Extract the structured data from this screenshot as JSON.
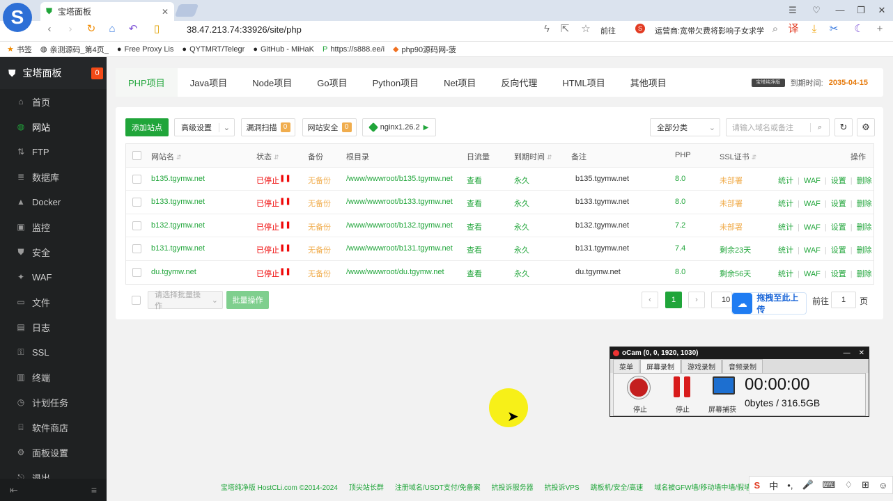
{
  "browser": {
    "tab_title": "宝塔面板",
    "url": "38.47.213.74:33926/site/php",
    "forward_label": "前往",
    "news_text": "运营商:宽带欠费将影响子女求学",
    "bookmarks": [
      {
        "icon": "star-icon",
        "label": "书签"
      },
      {
        "icon": "globe-icon",
        "label": "亲测源码_第4页_"
      },
      {
        "icon": "github-icon",
        "label": "Free Proxy Lis"
      },
      {
        "icon": "github-icon",
        "label": "QYTMRT/Telegr"
      },
      {
        "icon": "github-icon",
        "label": "GitHub - MiHaK"
      },
      {
        "icon": "tp-icon",
        "label": "https://s888.ee/i"
      },
      {
        "icon": "php-icon",
        "label": "php90源码网-菠"
      }
    ]
  },
  "sidebar": {
    "title": "宝塔面板",
    "badge": "0",
    "items": [
      {
        "label": "首页",
        "icon": "home-icon"
      },
      {
        "label": "网站",
        "icon": "globe-icon"
      },
      {
        "label": "FTP",
        "icon": "ftp-icon"
      },
      {
        "label": "数据库",
        "icon": "database-icon"
      },
      {
        "label": "Docker",
        "icon": "docker-icon"
      },
      {
        "label": "监控",
        "icon": "monitor-icon"
      },
      {
        "label": "安全",
        "icon": "shield-icon"
      },
      {
        "label": "WAF",
        "icon": "waf-icon"
      },
      {
        "label": "文件",
        "icon": "folder-icon"
      },
      {
        "label": "日志",
        "icon": "log-icon"
      },
      {
        "label": "SSL",
        "icon": "ssl-icon"
      },
      {
        "label": "终端",
        "icon": "terminal-icon"
      },
      {
        "label": "计划任务",
        "icon": "clock-icon"
      },
      {
        "label": "软件商店",
        "icon": "store-icon"
      },
      {
        "label": "面板设置",
        "icon": "gear-icon"
      },
      {
        "label": "退出",
        "icon": "logout-icon"
      }
    ]
  },
  "project_tabs": [
    "PHP项目",
    "Java项目",
    "Node项目",
    "Go项目",
    "Python项目",
    "Net项目",
    "反向代理",
    "HTML项目",
    "其他项目"
  ],
  "expiry": {
    "badge": "宝塔纯净版",
    "label": "到期时间:",
    "date": "2035-04-15"
  },
  "toolbar": {
    "add_site": "添加站点",
    "advanced": "高级设置",
    "vuln_scan": "漏洞扫描",
    "vuln_count": "0",
    "site_security": "网站安全",
    "security_count": "0",
    "nginx": "nginx1.26.2",
    "category": "全部分类",
    "search_placeholder": "请输入域名或备注"
  },
  "table": {
    "headers": {
      "name": "网站名",
      "status": "状态",
      "backup": "备份",
      "root": "根目录",
      "traffic": "日流量",
      "expire": "到期时间",
      "remark": "备注",
      "php": "PHP",
      "ssl": "SSL证书",
      "ops": "操作"
    },
    "rows": [
      {
        "name": "b135.tgymw.net",
        "status": "已停止",
        "backup": "无备份",
        "root": "/www/wwwroot/b135.tgymw.net",
        "traffic": "查看",
        "expire": "永久",
        "remark": "b135.tgymw.net",
        "php": "8.0",
        "ssl": "未部署",
        "ssl_color": "#f0ad4e"
      },
      {
        "name": "b133.tgymw.net",
        "status": "已停止",
        "backup": "无备份",
        "root": "/www/wwwroot/b133.tgymw.net",
        "traffic": "查看",
        "expire": "永久",
        "remark": "b133.tgymw.net",
        "php": "8.0",
        "ssl": "未部署",
        "ssl_color": "#f0ad4e"
      },
      {
        "name": "b132.tgymw.net",
        "status": "已停止",
        "backup": "无备份",
        "root": "/www/wwwroot/b132.tgymw.net",
        "traffic": "查看",
        "expire": "永久",
        "remark": "b132.tgymw.net",
        "php": "7.2",
        "ssl": "未部署",
        "ssl_color": "#f0ad4e"
      },
      {
        "name": "b131.tgymw.net",
        "status": "已停止",
        "backup": "无备份",
        "root": "/www/wwwroot/b131.tgymw.net",
        "traffic": "查看",
        "expire": "永久",
        "remark": "b131.tgymw.net",
        "php": "7.4",
        "ssl": "剩余23天",
        "ssl_color": "#20a53a"
      },
      {
        "name": "du.tgymw.net",
        "status": "已停止",
        "backup": "无备份",
        "root": "/www/wwwroot/du.tgymw.net",
        "traffic": "查看",
        "expire": "永久",
        "remark": "du.tgymw.net",
        "php": "8.0",
        "ssl": "剩余56天",
        "ssl_color": "#20a53a"
      }
    ],
    "ops": [
      "统计",
      "WAF",
      "设置",
      "删除"
    ]
  },
  "batch": {
    "select_placeholder": "请选择批量操作",
    "button": "批量操作"
  },
  "pagination": {
    "current": "1",
    "page_size": "10",
    "goto_label": "前往",
    "goto_value": "1",
    "page_suffix": "页"
  },
  "upload": {
    "label": "拖拽至此上传"
  },
  "footer": [
    "宝塔纯净版 HostCLi.com ©2014-2024",
    "顶尖站长群",
    "注册域名/USDT支付/免备案",
    "抗投诉服务器",
    "抗投诉VPS",
    "跳板机/安全/高速",
    "域名被GFW墙/移动墙中墙/假墙解决方案"
  ],
  "ocam": {
    "title": "oCam (0, 0, 1920, 1030)",
    "tabs": [
      "菜单",
      "屏幕录制",
      "游戏录制",
      "音频录制"
    ],
    "stop_label": "停止",
    "pause_label": "停止",
    "capture_label": "屏幕捕获",
    "time": "00:00:00",
    "size": "0bytes / 316.5GB"
  },
  "colors": {
    "accent": "#20a53a",
    "danger": "#ef0808",
    "warning": "#f0ad4e",
    "sidebar": "#1f2122"
  }
}
